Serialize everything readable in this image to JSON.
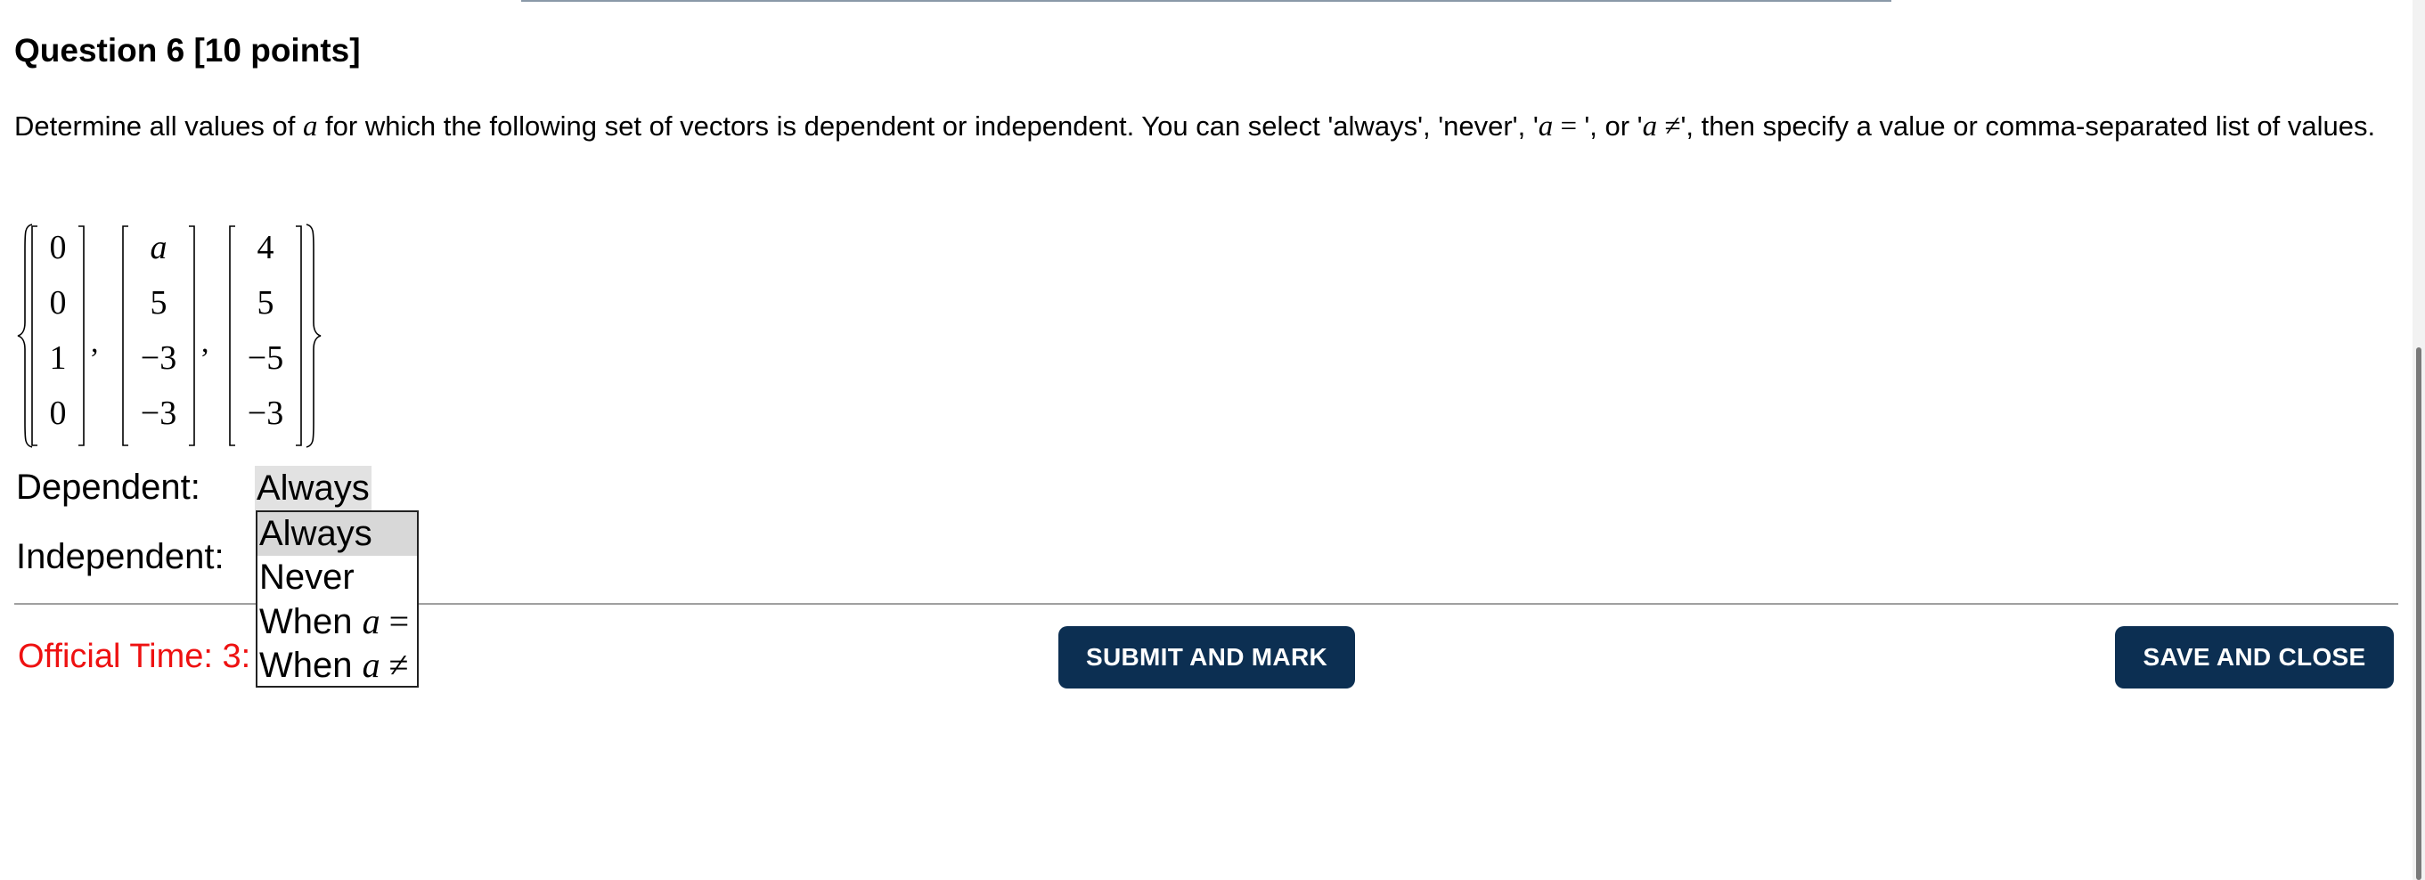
{
  "question": {
    "title": "Question 6 [10 points]",
    "prompt_before": "Determine all values of ",
    "prompt_var": "a",
    "prompt_middle": " for which the following set of vectors is dependent or independent. You can select 'always', 'never', '",
    "prompt_eq_var": "a",
    "prompt_eq_op": " = ",
    "prompt_or": "', or '",
    "prompt_neq_var": "a",
    "prompt_neq_op": " ≠",
    "prompt_end": "', then specify a value or comma-separated list of values."
  },
  "vectors": [
    [
      "0",
      "0",
      "1",
      "0"
    ],
    [
      "a",
      "5",
      "−3",
      "−3"
    ],
    [
      "4",
      "5",
      "−5",
      "−3"
    ]
  ],
  "vector_separator": ",",
  "dependent": {
    "label": "Dependent:",
    "value": "Always"
  },
  "independent": {
    "label": "Independent:",
    "options": [
      {
        "text": "Always",
        "var": "",
        "op": ""
      },
      {
        "text": "Never",
        "var": "",
        "op": ""
      },
      {
        "text": "When ",
        "var": "a",
        "op": " ="
      },
      {
        "text": "When ",
        "var": "a",
        "op": " ≠"
      }
    ],
    "selected_index": 0
  },
  "timer": {
    "text": "Official Time: 3:"
  },
  "buttons": {
    "submit": "SUBMIT AND MARK",
    "save": "SAVE AND CLOSE"
  },
  "colors": {
    "button_bg": "#0c2f52",
    "timer_text": "#ee1111",
    "selected_option_bg": "#d8d8d8"
  }
}
